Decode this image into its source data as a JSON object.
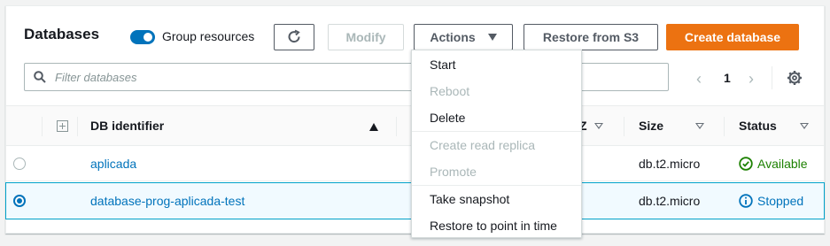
{
  "header": {
    "title": "Databases",
    "group_toggle_label": "Group resources",
    "group_toggle_on": true
  },
  "toolbar": {
    "modify_label": "Modify",
    "actions_label": "Actions",
    "restore_label": "Restore from S3",
    "create_label": "Create database"
  },
  "search": {
    "placeholder": "Filter databases"
  },
  "pagination": {
    "current_page": "1"
  },
  "table": {
    "columns": [
      "DB identifier",
      "Z",
      "Size",
      "Status"
    ],
    "rows": [
      {
        "id": "aplicada",
        "size": "db.t2.micro",
        "status": "Available",
        "selected": false
      },
      {
        "id": "database-prog-aplicada-test",
        "size": "db.t2.micro",
        "status": "Stopped",
        "selected": true
      }
    ]
  },
  "actions_menu": {
    "items": [
      {
        "label": "Start",
        "disabled": false
      },
      {
        "label": "Reboot",
        "disabled": true
      },
      {
        "label": "Delete",
        "disabled": false
      },
      {
        "label": "Create read replica",
        "disabled": true
      },
      {
        "label": "Promote",
        "disabled": true
      },
      {
        "label": "Take snapshot",
        "disabled": false
      },
      {
        "label": "Restore to point in time",
        "disabled": false
      }
    ]
  },
  "colors": {
    "primary": "#ec7211",
    "link": "#0073bb",
    "available": "#1d8102"
  }
}
